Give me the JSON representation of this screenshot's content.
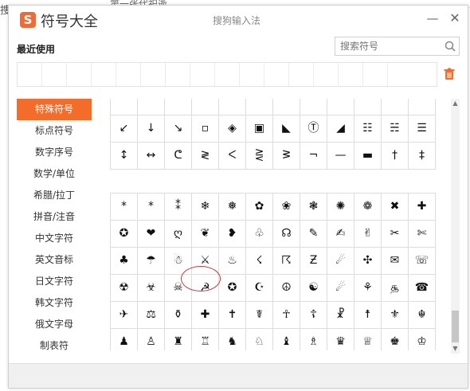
{
  "background": {
    "left_text": "捜",
    "top_text": "第一张代祀逝"
  },
  "window": {
    "app_title": "符号大全",
    "logo_text": "S",
    "title": "搜狗输入法",
    "minimize_label": "—",
    "close_label": "✕"
  },
  "recent": {
    "label": "最近使用",
    "cells": 16
  },
  "search": {
    "placeholder": "搜索符号",
    "value": ""
  },
  "sidebar": {
    "items": [
      {
        "label": "特殊符号",
        "active": true
      },
      {
        "label": "标点符号",
        "active": false
      },
      {
        "label": "数字序号",
        "active": false
      },
      {
        "label": "数学/单位",
        "active": false
      },
      {
        "label": "希腊/拉丁",
        "active": false
      },
      {
        "label": "拼音/注音",
        "active": false
      },
      {
        "label": "中文字符",
        "active": false
      },
      {
        "label": "英文音标",
        "active": false
      },
      {
        "label": "日文字符",
        "active": false
      },
      {
        "label": "韩文字符",
        "active": false
      },
      {
        "label": "俄文字母",
        "active": false
      },
      {
        "label": "制表符",
        "active": false
      }
    ]
  },
  "symbols_top": [
    [
      "",
      "",
      "",
      "",
      "",
      "",
      "",
      "",
      "",
      "",
      "",
      ""
    ],
    [
      "↙",
      "↓",
      "↘",
      "▫",
      "◈",
      "▣",
      "◣",
      "Ⓣ",
      "◢",
      "☷",
      "☵",
      "☰"
    ],
    [
      "↕",
      "↔",
      "ᕦ",
      "≷",
      "ᐸ",
      "⋛",
      "ᕒ",
      "¬",
      "—",
      "▬",
      "†",
      "‡"
    ]
  ],
  "symbols_bottom": [
    [
      "*",
      "*",
      "⁑",
      "❄",
      "❅",
      "✿",
      "❀",
      "❃",
      "✺",
      "❁",
      "✖",
      "✚"
    ],
    [
      "✪",
      "❤",
      "ღ",
      "❦",
      "❥",
      "♧",
      "☊",
      "✎",
      "✍",
      "✌",
      "✂",
      "✄"
    ],
    [
      "♣",
      "☂",
      "☃",
      "⚔",
      "♨",
      "☇",
      "☈",
      "Ƶ",
      "☄",
      "✣",
      "✉",
      "☏"
    ],
    [
      "☢",
      "☣",
      "☠",
      "☭",
      "✪",
      "☪",
      "☮",
      "☯",
      "☄",
      "⚘",
      "௲",
      "☎"
    ],
    [
      "✈",
      "⚖",
      "⚱",
      "✚",
      "✝",
      "☤",
      "☥",
      "☦",
      "☧",
      "☨",
      "⚜",
      "☬"
    ],
    [
      "♟",
      "♙",
      "♜",
      "♖",
      "♞",
      "♘",
      "♝",
      "♗",
      "♛",
      "♕",
      "♚",
      "♔"
    ]
  ],
  "colors": {
    "accent": "#f36c2a",
    "highlight_ring": "#c23a3a",
    "grid_line": "#dddddd"
  }
}
